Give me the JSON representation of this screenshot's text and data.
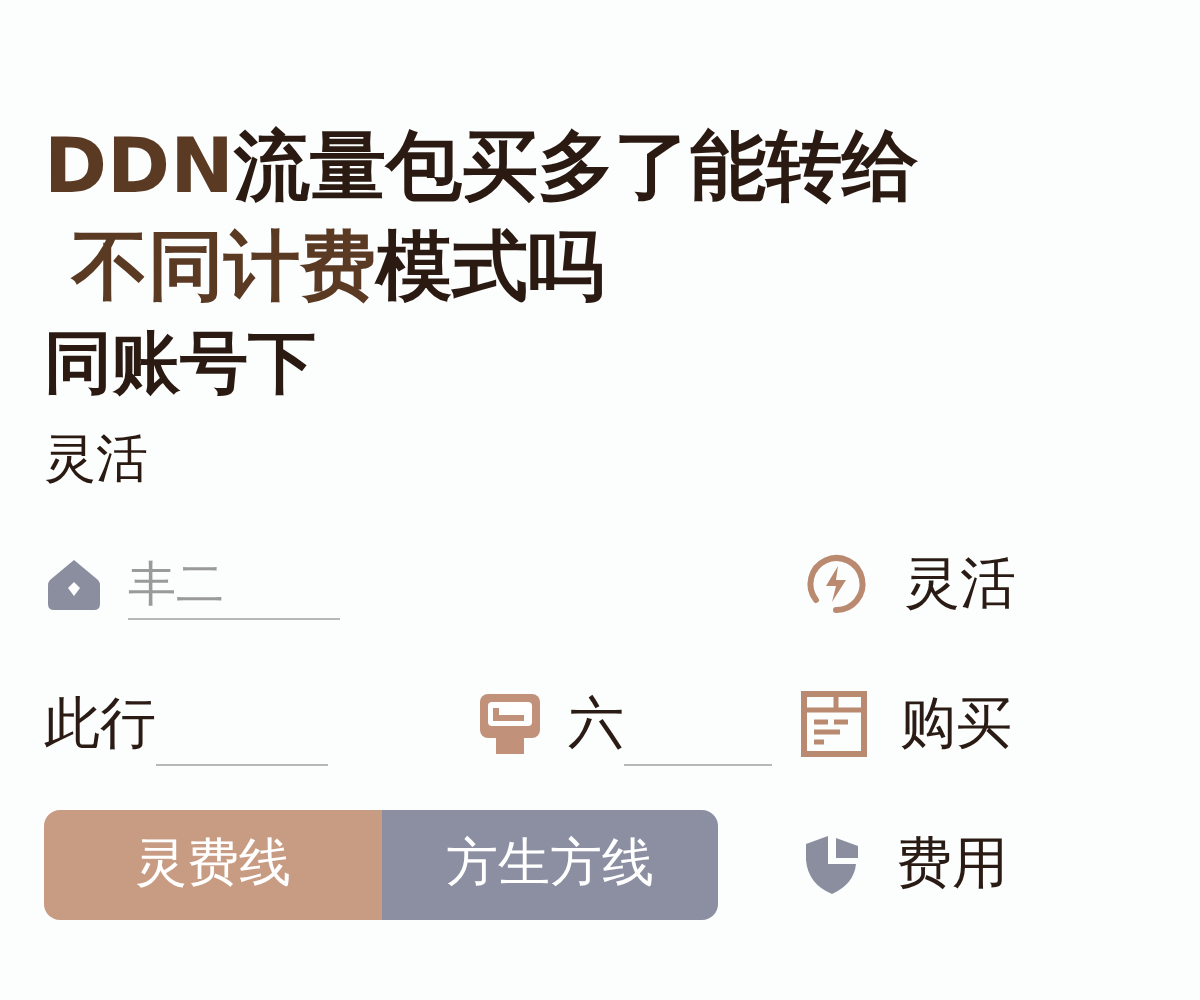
{
  "title": {
    "lines": [
      [
        {
          "text": "DDN",
          "accent": true
        },
        {
          "text": "流量包买多了能转给",
          "accent": false
        }
      ],
      [
        {
          "text": "不同计费",
          "accent": true
        },
        {
          "text": "模式吗",
          "accent": false
        }
      ]
    ]
  },
  "subtitle": "同账号下",
  "section_label": "灵活",
  "rows": [
    {
      "left": [
        {
          "kind": "icon_field",
          "placeholder": "丰二"
        }
      ],
      "right": {
        "label": "灵活"
      }
    },
    {
      "left": [
        {
          "kind": "label_blank",
          "label": "此行"
        },
        {
          "kind": "icon_label_blank",
          "label": "六"
        }
      ],
      "right": {
        "label": "购买"
      }
    },
    {
      "left": [
        {
          "kind": "segmented",
          "segments": [
            {
              "label": "灵费线",
              "selected": true
            },
            {
              "label": "方生方线",
              "selected": false
            }
          ]
        }
      ],
      "right": {
        "label": "费用"
      }
    }
  ]
}
